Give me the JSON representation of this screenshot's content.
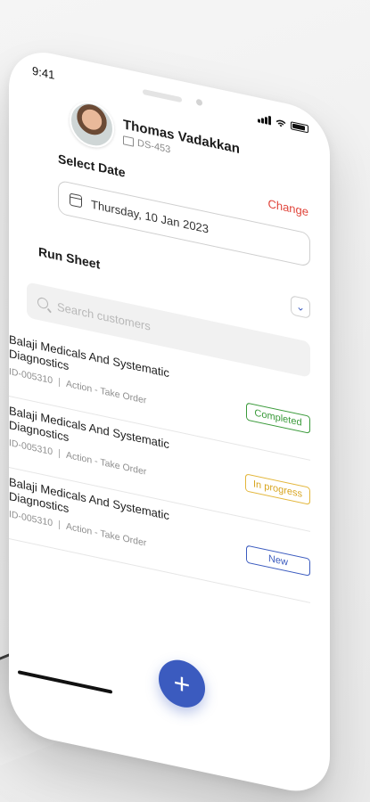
{
  "status_bar": {
    "time": "9:41"
  },
  "profile": {
    "name": "Thomas Vadakkan",
    "employee_id": "DS-453"
  },
  "date_section": {
    "title": "Select Date",
    "change_label": "Change",
    "date_value": "Thursday, 10 Jan 2023"
  },
  "run_sheet": {
    "title": "Run Sheet"
  },
  "search": {
    "placeholder": "Search customers"
  },
  "orders": [
    {
      "name": "Balaji Medicals And Systematic Diagnostics",
      "id": "ID-005310",
      "action": "Action - Take Order",
      "status": "Completed"
    },
    {
      "name": "Balaji Medicals And Systematic Diagnostics",
      "id": "ID-005310",
      "action": "Action - Take Order",
      "status": "In progress"
    },
    {
      "name": "Balaji Medicals And Systematic Diagnostics",
      "id": "ID-005310",
      "action": "Action - Take Order",
      "status": "New"
    }
  ],
  "fab": {
    "label": "+"
  },
  "colors": {
    "primary": "#3b5bbf",
    "danger": "#e0443a",
    "completed": "#3a9a3a",
    "in_progress": "#d8a520",
    "new": "#3b5bbf"
  }
}
